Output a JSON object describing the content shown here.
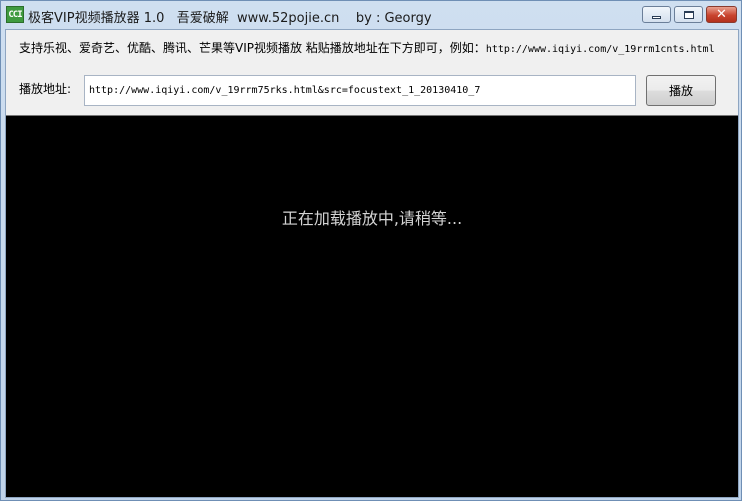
{
  "window": {
    "title": "极客VIP视频播放器 1.0   吾爱破解  www.52pojie.cn    by : Georgy",
    "icon_text": "CCI",
    "controls": {
      "minimize": "minimize-icon",
      "maximize": "maximize-icon",
      "close": "✕"
    }
  },
  "hint": {
    "text": "支持乐视、爱奇艺、优酷、腾讯、芒果等VIP视频播放 粘贴播放地址在下方即可，例如：",
    "example_url": "http://www.iqiyi.com/v_19rrm1cnts.html"
  },
  "address": {
    "label": "播放地址:",
    "value": "http://www.iqiyi.com/v_19rrm75rks.html&src=focustext_1_20130410_7"
  },
  "play_button": {
    "label": "播放"
  },
  "player": {
    "status": "正在加载播放中,请稍等..."
  },
  "colors": {
    "player_bg": "#000000",
    "status_text": "#d4d4d4",
    "title_bar": "#c9daec"
  }
}
